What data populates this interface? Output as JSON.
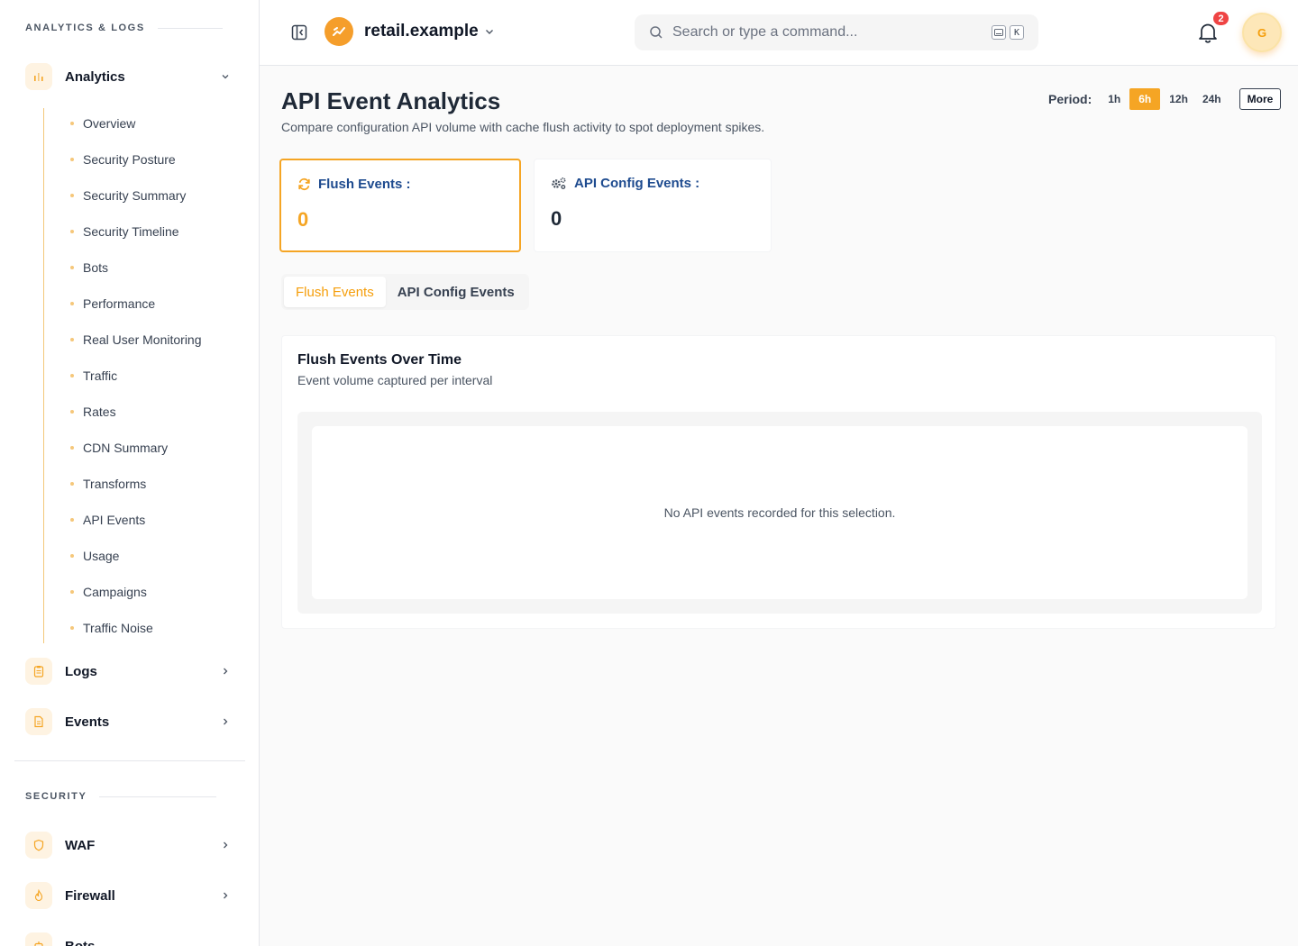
{
  "sidebar": {
    "section_analytics": "ANALYTICS & LOGS",
    "analytics": {
      "label": "Analytics",
      "icon": "bar-chart-icon"
    },
    "analytics_items": [
      "Overview",
      "Security Posture",
      "Security Summary",
      "Security Timeline",
      "Bots",
      "Performance",
      "Real User Monitoring",
      "Traffic",
      "Rates",
      "CDN Summary",
      "Transforms",
      "API Events",
      "Usage",
      "Campaigns",
      "Traffic Noise"
    ],
    "logs": {
      "label": "Logs",
      "icon": "clipboard-icon"
    },
    "events": {
      "label": "Events",
      "icon": "document-icon"
    },
    "section_security": "SECURITY",
    "waf": {
      "label": "WAF",
      "icon": "shield-icon"
    },
    "firewall": {
      "label": "Firewall",
      "icon": "flame-icon"
    },
    "bots": {
      "label": "Bots",
      "icon": "bot-icon"
    }
  },
  "header": {
    "site_name": "retail.example",
    "search_placeholder": "Search or type a command...",
    "shortcut_key": "K",
    "notification_count": "2",
    "avatar_initial": "G"
  },
  "main": {
    "title": "API Event Analytics",
    "description": "Compare configuration API volume with cache flush activity to spot deployment spikes.",
    "period_label": "Period:",
    "periods": [
      "1h",
      "6h",
      "12h",
      "24h"
    ],
    "active_period": "6h",
    "more_label": "More",
    "cards": [
      {
        "label": "Flush Events :",
        "value": "0",
        "icon": "refresh-icon",
        "active": true
      },
      {
        "label": "API Config Events :",
        "value": "0",
        "icon": "gears-icon",
        "active": false
      }
    ],
    "tabs": [
      "Flush Events",
      "API Config Events"
    ],
    "active_tab": "Flush Events",
    "chart": {
      "title": "Flush Events Over Time",
      "subtitle": "Event volume captured per interval",
      "empty_message": "No API events recorded for this selection."
    }
  },
  "colors": {
    "accent": "#f5a524",
    "link_blue": "#1e4b8f",
    "badge_red": "#ef4444"
  }
}
